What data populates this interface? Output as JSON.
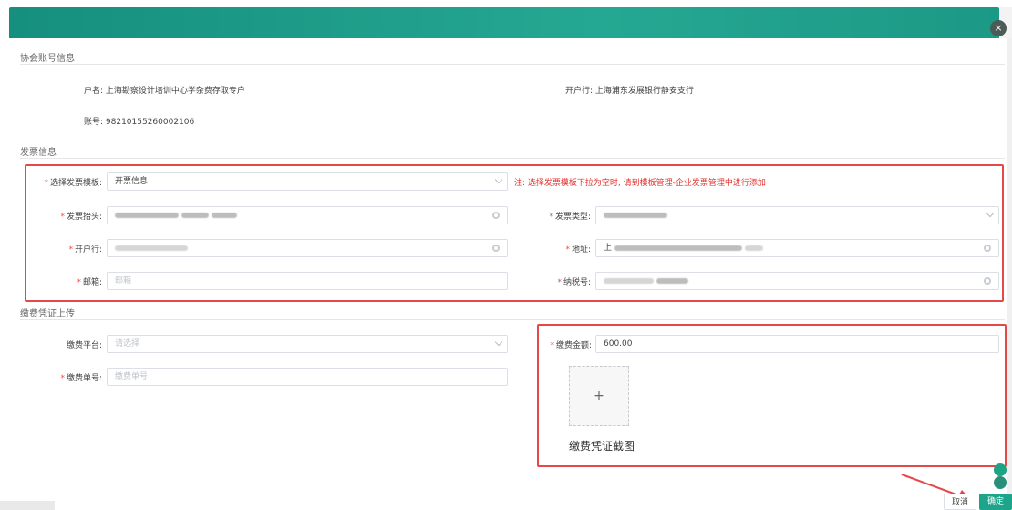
{
  "dialog": {
    "close_glyph": "×"
  },
  "account_section": {
    "title": "协会账号信息",
    "account_name": "户名: 上海勘察设计培训中心学杂费存取专户",
    "bank": "开户行: 上海浦东发展银行静安支行",
    "account_number": "账号: 98210155260002106"
  },
  "invoice_section": {
    "title": "发票信息",
    "template_label": "选择发票模板:",
    "template_value": "开票信息",
    "template_note": "注: 选择发票模板下拉为空时, 请到模板管理-企业发票管理中进行添加",
    "header_label": "发票抬头:",
    "type_label": "发票类型:",
    "bank_label": "开户行:",
    "address_label": "地址:",
    "address_prefix": "上",
    "email_label": "邮箱:",
    "email_placeholder": "邮箱",
    "tax_label": "纳税号:"
  },
  "payment_section": {
    "title": "缴费凭证上传",
    "platform_label": "缴费平台:",
    "platform_placeholder": "请选择",
    "order_label": "缴费单号:",
    "order_placeholder": "缴费单号",
    "amount_label": "缴费金额:",
    "amount_value": "600.00",
    "upload_plus": "+",
    "upload_label": "缴费凭证截图"
  },
  "footer": {
    "cancel_label": "取消",
    "ok_label": "确定"
  },
  "icons": [
    "close-icon",
    "chevron-down-icon",
    "clear-icon",
    "plus-icon",
    "arrow-icon",
    "float-chat-icon"
  ],
  "colors": {
    "header_teal": "#1f9e8c",
    "required_red": "#f04848",
    "highlight_red": "#e24a4a",
    "primary_button": "#1ca58a"
  }
}
